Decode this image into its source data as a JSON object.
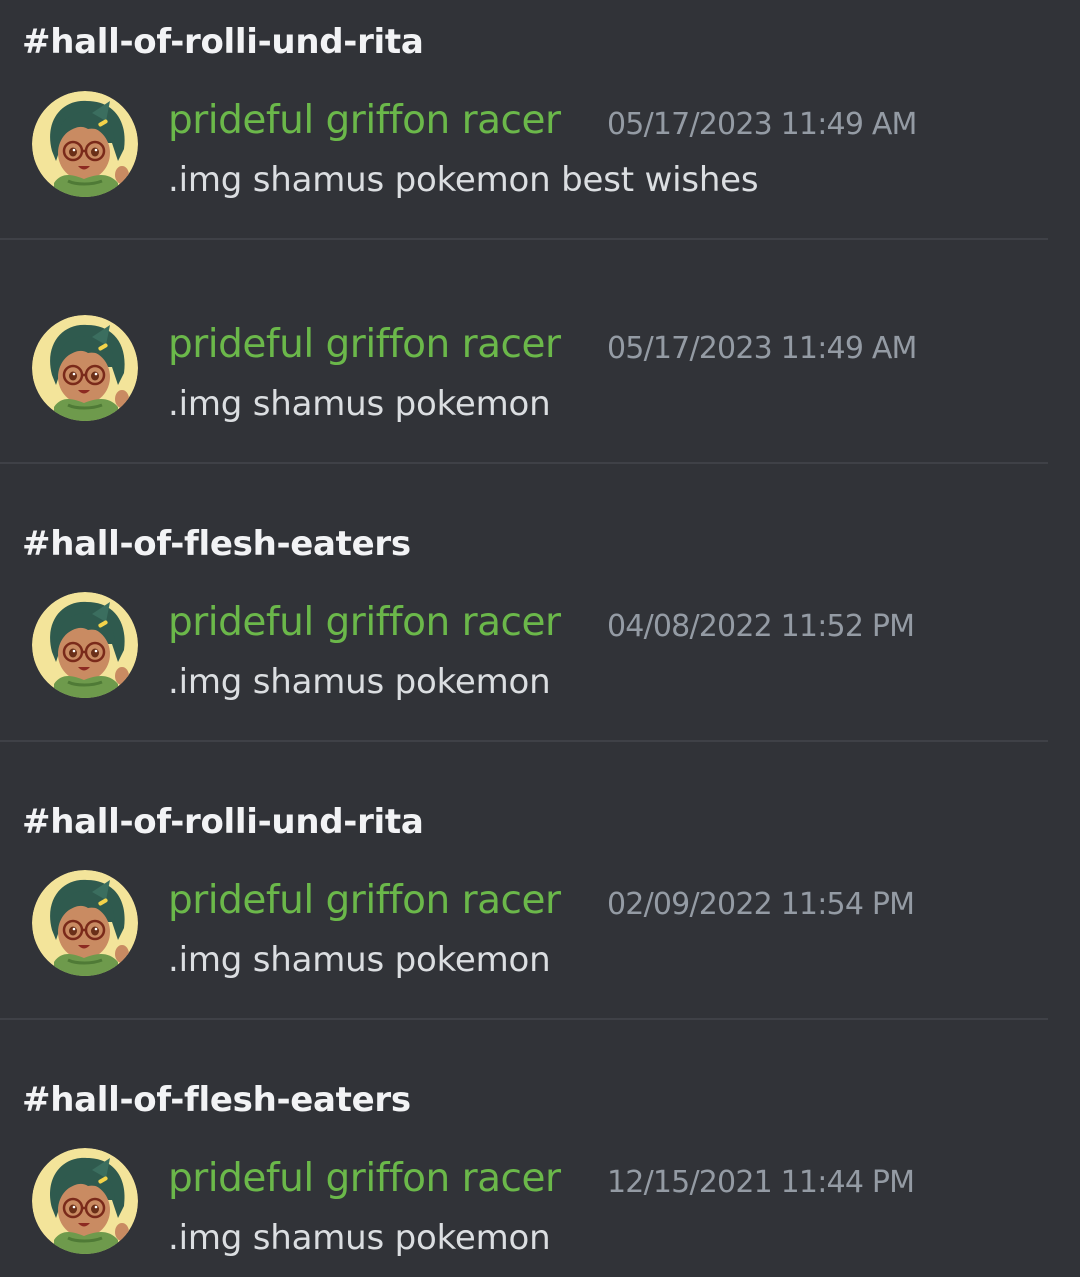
{
  "results": [
    {
      "channel": "#hall-of-rolli-und-rita",
      "author": "prideful griffon racer",
      "timestamp": "05/17/2023 11:49 AM",
      "content": ".img shamus pokemon best wishes"
    },
    {
      "channel": "",
      "author": "prideful griffon racer",
      "timestamp": "05/17/2023 11:49 AM",
      "content": ".img shamus pokemon"
    },
    {
      "channel": "#hall-of-flesh-eaters",
      "author": "prideful griffon racer",
      "timestamp": "04/08/2022 11:52 PM",
      "content": ".img shamus pokemon"
    },
    {
      "channel": "#hall-of-rolli-und-rita",
      "author": "prideful griffon racer",
      "timestamp": "02/09/2022 11:54 PM",
      "content": ".img shamus pokemon"
    },
    {
      "channel": "#hall-of-flesh-eaters",
      "author": "prideful griffon racer",
      "timestamp": "12/15/2021 11:44 PM",
      "content": ".img shamus pokemon"
    }
  ],
  "colors": {
    "background": "#313338",
    "author": "#6bb84a",
    "timestamp": "#949ba4",
    "channel": "#f2f3f5",
    "content": "#dbdee1",
    "divider": "#3f4147"
  },
  "icons": {
    "avatar": "user-avatar-illustration"
  }
}
